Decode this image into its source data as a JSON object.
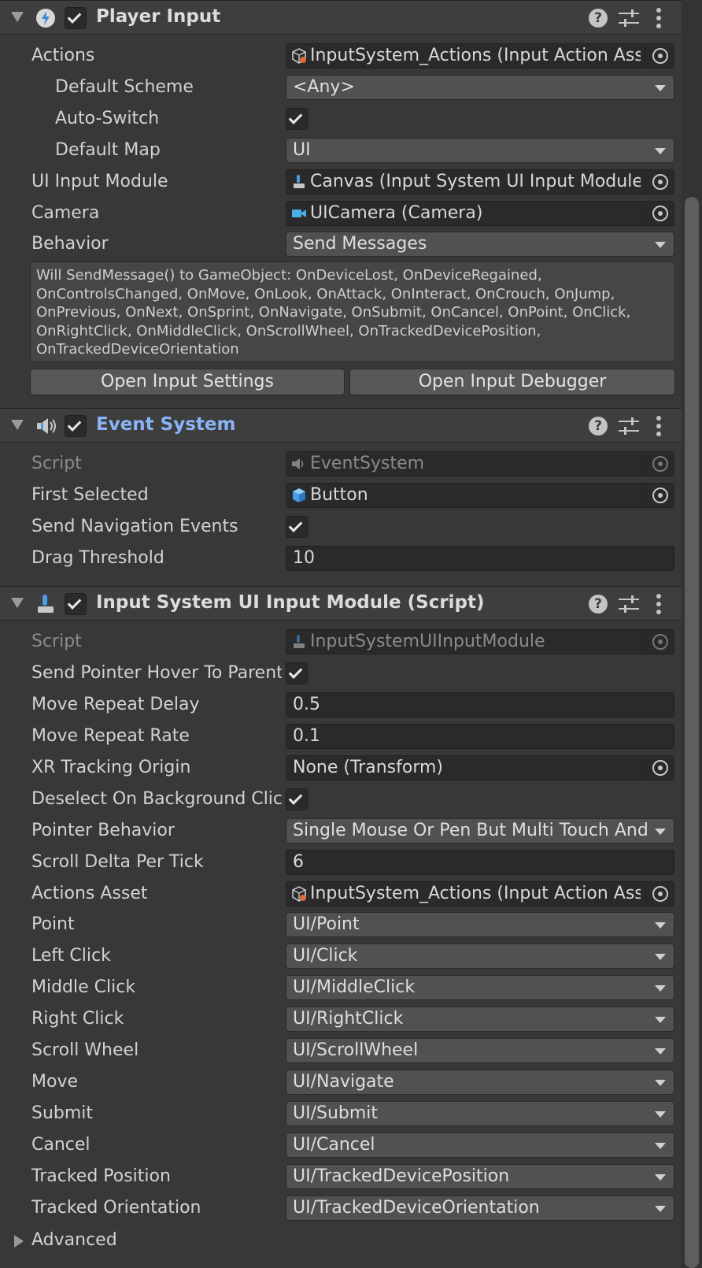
{
  "player_input": {
    "title": "Player Input",
    "enabled": true,
    "fields": {
      "actions": {
        "label": "Actions",
        "value": "InputSystem_Actions (Input Action Asset)"
      },
      "default_scheme": {
        "label": "Default Scheme",
        "value": "<Any>"
      },
      "auto_switch": {
        "label": "Auto-Switch",
        "checked": true
      },
      "default_map": {
        "label": "Default Map",
        "value": "UI"
      },
      "ui_input_module": {
        "label": "UI Input Module",
        "value": "Canvas (Input System UI Input Module)"
      },
      "camera": {
        "label": "Camera",
        "value": "UICamera (Camera)"
      },
      "behavior": {
        "label": "Behavior",
        "value": "Send Messages"
      }
    },
    "help_text": "Will SendMessage() to GameObject: OnDeviceLost, OnDeviceRegained, OnControlsChanged, OnMove, OnLook, OnAttack, OnInteract, OnCrouch, OnJump, OnPrevious, OnNext, OnSprint, OnNavigate, OnSubmit, OnCancel, OnPoint, OnClick, OnRightClick, OnMiddleClick, OnScrollWheel, OnTrackedDevicePosition, OnTrackedDeviceOrientation",
    "open_settings_label": "Open Input Settings",
    "open_debugger_label": "Open Input Debugger"
  },
  "event_system": {
    "title": "Event System",
    "enabled": true,
    "fields": {
      "script": {
        "label": "Script",
        "value": "EventSystem"
      },
      "first_selected": {
        "label": "First Selected",
        "value": "Button"
      },
      "send_navigation_events": {
        "label": "Send Navigation Events",
        "checked": true
      },
      "drag_threshold": {
        "label": "Drag Threshold",
        "value": "10"
      }
    }
  },
  "input_module": {
    "title": "Input System UI Input Module (Script)",
    "enabled": true,
    "fields": {
      "script": {
        "label": "Script",
        "value": "InputSystemUIInputModule"
      },
      "send_pointer_hover": {
        "label": "Send Pointer Hover To Parent",
        "checked": true
      },
      "move_repeat_delay": {
        "label": "Move Repeat Delay",
        "value": "0.5"
      },
      "move_repeat_rate": {
        "label": "Move Repeat Rate",
        "value": "0.1"
      },
      "xr_tracking_origin": {
        "label": "XR Tracking Origin",
        "value": "None (Transform)"
      },
      "deselect_on_background": {
        "label": "Deselect On Background Click",
        "checked": true
      },
      "pointer_behavior": {
        "label": "Pointer Behavior",
        "value": "Single Mouse Or Pen But Multi Touch And Track"
      },
      "scroll_delta": {
        "label": "Scroll Delta Per Tick",
        "value": "6"
      },
      "actions_asset": {
        "label": "Actions Asset",
        "value": "InputSystem_Actions (Input Action Asset)"
      },
      "point": {
        "label": "Point",
        "value": "UI/Point"
      },
      "left_click": {
        "label": "Left Click",
        "value": "UI/Click"
      },
      "middle_click": {
        "label": "Middle Click",
        "value": "UI/MiddleClick"
      },
      "right_click": {
        "label": "Right Click",
        "value": "UI/RightClick"
      },
      "scroll_wheel": {
        "label": "Scroll Wheel",
        "value": "UI/ScrollWheel"
      },
      "move": {
        "label": "Move",
        "value": "UI/Navigate"
      },
      "submit": {
        "label": "Submit",
        "value": "UI/Submit"
      },
      "cancel": {
        "label": "Cancel",
        "value": "UI/Cancel"
      },
      "tracked_position": {
        "label": "Tracked Position",
        "value": "UI/TrackedDevicePosition"
      },
      "tracked_orientation": {
        "label": "Tracked Orientation",
        "value": "UI/TrackedDeviceOrientation"
      }
    },
    "advanced_label": "Advanced"
  },
  "icons": {
    "foldout": "triangle-down-icon",
    "help": "help-icon",
    "presets": "sliders-icon",
    "menu": "kebab-menu-icon",
    "object_picker": "object-picker-icon"
  },
  "colors": {
    "background": "#383838",
    "header": "#3e3e3e",
    "field": "#2a2a2a",
    "dropdown": "#515151",
    "accent_title": "#8ab4f8"
  }
}
